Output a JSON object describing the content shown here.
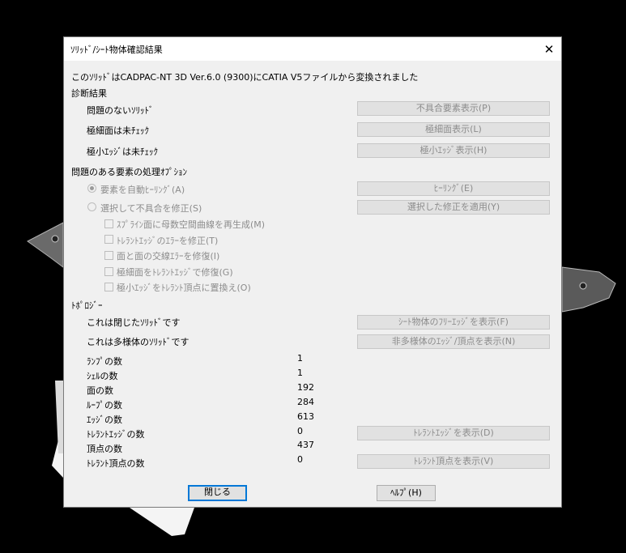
{
  "dialog": {
    "title": "ｿﾘｯﾄﾞ/ｼｰﾄ物体確認結果",
    "close_symbol": "✕",
    "conversion_message": "このｿﾘｯﾄﾞはCADPAC-NT 3D Ver.6.0 (9300)にCATIA V5ファイルから変換されました",
    "diagnosis": {
      "heading": "診断結果",
      "rows": [
        {
          "label": "問題のないｿﾘｯﾄﾞ",
          "button": "不具合要素表示(P)"
        },
        {
          "label": "極細面は未ﾁｪｯｸ",
          "button": "極細面表示(L)"
        },
        {
          "label": "極小ｴｯｼﾞは未ﾁｪｯｸ",
          "button": "極小ｴｯｼﾞ表示(H)"
        }
      ]
    },
    "processing": {
      "heading": "問題のある要素の処理ｵﾌﾟｼｮﾝ",
      "radio_auto": "要素を自動ﾋｰﾘﾝｸﾞ(A)",
      "radio_select": "選択して不具合を修正(S)",
      "healing_button": "ﾋｰﾘﾝｸﾞ(E)",
      "apply_button": "選択した修正を適用(Y)",
      "checkboxes": [
        "ｽﾌﾟﾗｲﾝ面に母数空間曲線を再生成(M)",
        "ﾄﾚﾗﾝﾄｴｯｼﾞのｴﾗｰを修正(T)",
        "面と面の交線ｴﾗｰを修復(I)",
        "極細面をﾄﾚﾗﾝﾄｴｯｼﾞで修復(G)",
        "極小ｴｯｼﾞをﾄﾚﾗﾝﾄ頂点に置換え(O)"
      ]
    },
    "topology": {
      "heading": "ﾄﾎﾟﾛｼﾞｰ",
      "closed_label": "これは閉じたｿﾘｯﾄﾞです",
      "closed_button": "ｼｰﾄ物体のﾌﾘｰｴｯｼﾞを表示(F)",
      "manifold_label": "これは多様体のｿﾘｯﾄﾞです",
      "manifold_button": "非多様体のｴｯｼﾞ/頂点を表示(N)",
      "stats": [
        {
          "label": "ﾗﾝﾌﾟの数",
          "value": "1"
        },
        {
          "label": "ｼｪﾙの数",
          "value": "1"
        },
        {
          "label": "面の数",
          "value": "192"
        },
        {
          "label": "ﾙｰﾌﾟの数",
          "value": "284"
        },
        {
          "label": "ｴｯｼﾞの数",
          "value": "613"
        },
        {
          "label": "ﾄﾚﾗﾝﾄｴｯｼﾞの数",
          "value": "0"
        },
        {
          "label": "頂点の数",
          "value": "437"
        },
        {
          "label": "ﾄﾚﾗﾝﾄ頂点の数",
          "value": "0"
        }
      ],
      "tolerant_edge_button": "ﾄﾚﾗﾝﾄｴｯｼﾞを表示(D)",
      "tolerant_vertex_button": "ﾄﾚﾗﾝﾄ頂点を表示(V)"
    },
    "close_button": "閉じる",
    "help_button": "ﾍﾙﾌﾟ(H)"
  },
  "colors": {
    "accent": "#0078d7",
    "dialog_bg": "#f0f0f0",
    "disabled_text": "#8c8c8c"
  }
}
